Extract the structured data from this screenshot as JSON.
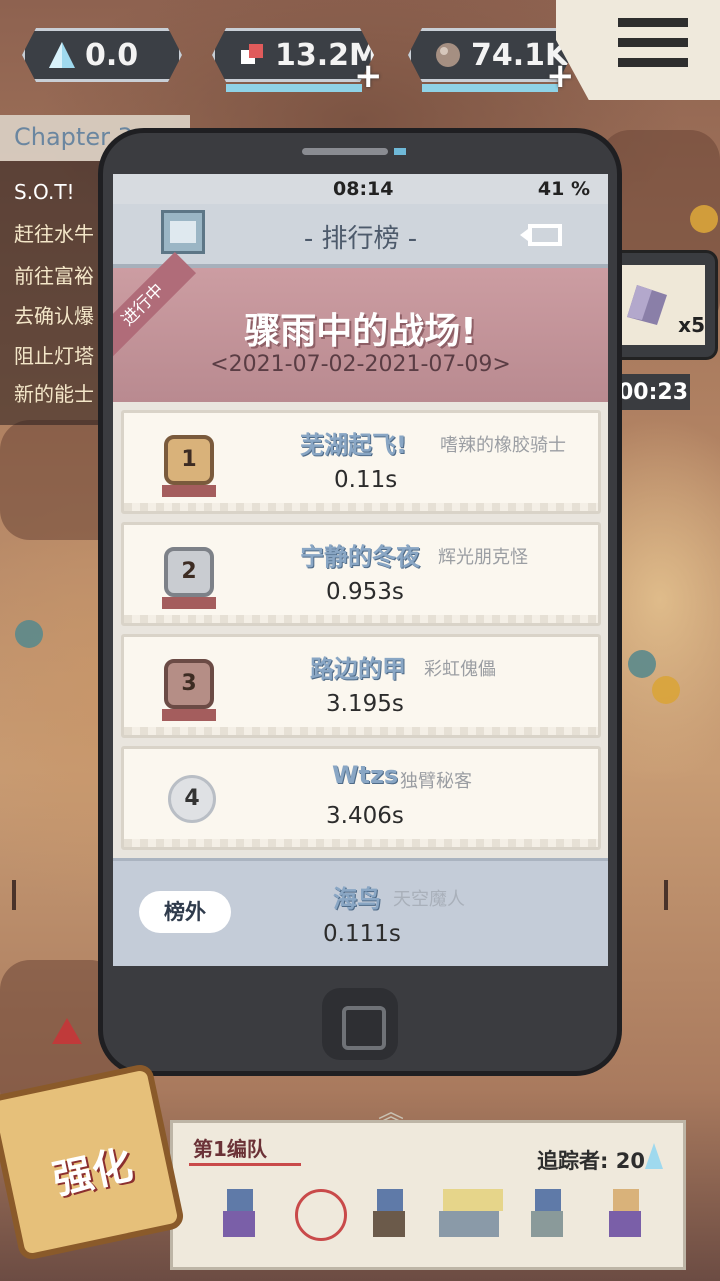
{
  "resources": [
    {
      "name": "crystal",
      "value": "0.0",
      "icon": "crystal-icon"
    },
    {
      "name": "cards",
      "value": "13.2M",
      "icon": "cards-icon"
    },
    {
      "name": "ore",
      "value": "74.1K",
      "icon": "ore-icon"
    }
  ],
  "plus_label": "+",
  "quest": {
    "chapter": "Chapter 3",
    "lines": [
      "S.O.T!",
      "赶往水牛",
      "前往富裕",
      "去确认爆",
      "阻止灯塔",
      "新的能士"
    ]
  },
  "phone": {
    "time": "08:14",
    "battery": "41 %",
    "title": "- 排行榜 -"
  },
  "event": {
    "badge": "进行中",
    "title": "骤雨中的战场!",
    "date_range": "<2021-07-02-2021-07-09>"
  },
  "leaderboard": [
    {
      "rank": "1",
      "player": "芜湖起飞!",
      "team": "嗜辣的橡胶骑士",
      "time": "0.11s"
    },
    {
      "rank": "2",
      "player": "宁静的冬夜",
      "team": "辉光朋克怪",
      "time": "0.953s"
    },
    {
      "rank": "3",
      "player": "路边的甲",
      "team": "彩虹傀儡",
      "time": "3.195s"
    },
    {
      "rank": "4",
      "player": "Wtzs",
      "team": "独臂秘客",
      "time": "3.406s"
    }
  ],
  "my_entry": {
    "badge": "榜外",
    "player": "海鸟",
    "team": "天空魔人",
    "time": "0.111s"
  },
  "chest": {
    "count": "x5",
    "timer": "00:23"
  },
  "team": {
    "label": "第1编队",
    "tracker": "追踪者: 20"
  },
  "strengthen_label": "强化",
  "colors": {
    "accent_blue": "#8fd2e6",
    "event_pink": "#cc9da2",
    "gold_medal": "#d9b27a",
    "silver_medal": "#c9ccd1",
    "bronze_medal": "#b58e86"
  }
}
